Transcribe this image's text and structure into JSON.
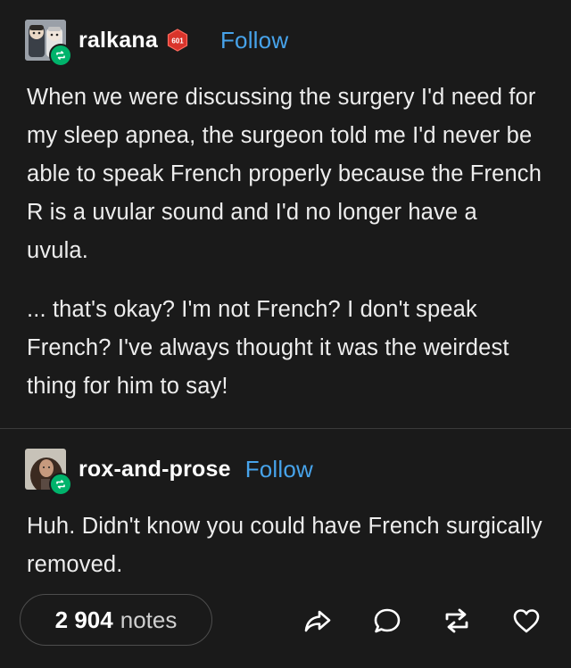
{
  "post": {
    "original": {
      "username": "ralkana",
      "follow_label": "Follow",
      "badge_text": "601",
      "paragraphs": [
        "When we were discussing the surgery I'd need for my sleep apnea, the surgeon told me I'd never be able to speak French properly because the French R is a uvular sound and I'd no longer have a uvula.",
        "... that's okay? I'm not French? I don't speak French? I've always thought it was the weirdest thing for him to say!"
      ]
    },
    "reblog": {
      "username": "rox-and-prose",
      "follow_label": "Follow",
      "paragraphs": [
        "Huh. Didn't know you could have French surgically removed."
      ]
    }
  },
  "footer": {
    "notes_count": "2 904",
    "notes_label": "notes",
    "actions": [
      "share-icon",
      "reply-icon",
      "reblog-icon",
      "like-icon"
    ]
  },
  "colors": {
    "background": "#1a1a1a",
    "link": "#47a3ea",
    "reblog_badge": "#00b36b"
  }
}
